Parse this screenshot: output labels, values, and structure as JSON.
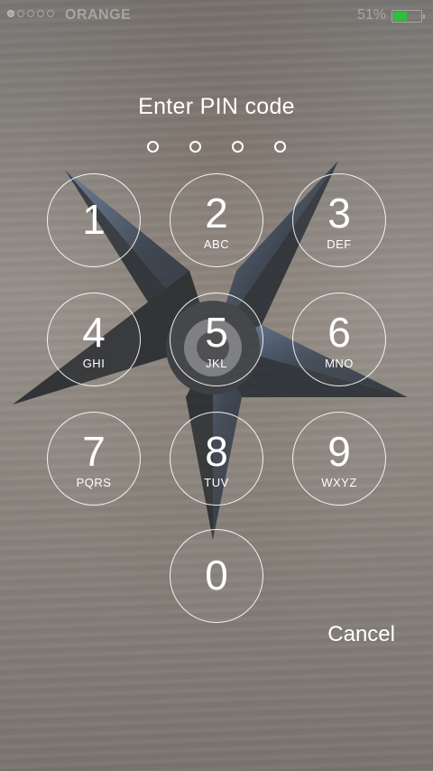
{
  "status_bar": {
    "carrier": "ORANGE",
    "battery_percent": "51%",
    "battery_level": 0.51,
    "battery_color": "#2fbf3a"
  },
  "prompt": {
    "title": "Enter PIN code",
    "pin_length": 4
  },
  "keypad": {
    "keys": [
      {
        "digit": "1",
        "letters": ""
      },
      {
        "digit": "2",
        "letters": "ABC"
      },
      {
        "digit": "3",
        "letters": "DEF"
      },
      {
        "digit": "4",
        "letters": "GHI"
      },
      {
        "digit": "5",
        "letters": "JKL"
      },
      {
        "digit": "6",
        "letters": "MNO"
      },
      {
        "digit": "7",
        "letters": "PQRS"
      },
      {
        "digit": "8",
        "letters": "TUV"
      },
      {
        "digit": "9",
        "letters": "WXYZ"
      },
      {
        "digit": "0",
        "letters": ""
      }
    ]
  },
  "actions": {
    "cancel_label": "Cancel"
  },
  "colors": {
    "text": "#ffffff",
    "ring": "#ffffff"
  }
}
